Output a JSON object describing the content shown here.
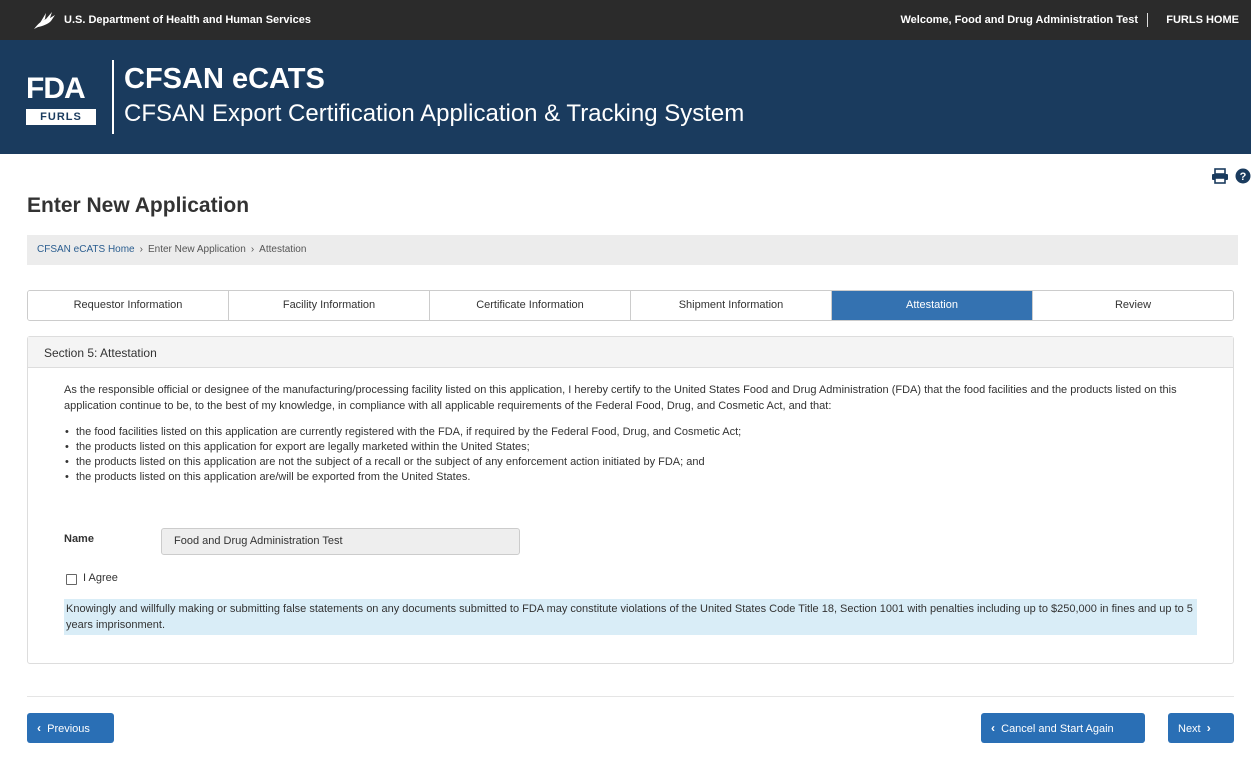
{
  "topbar": {
    "agency": "U.S. Department of Health and Human Services",
    "welcome": "Welcome, Food and Drug Administration Test",
    "home_link": "FURLS HOME"
  },
  "banner": {
    "logo_text": "FDA",
    "logo_sub": "FURLS",
    "title": "CFSAN eCATS",
    "subtitle": "CFSAN Export Certification Application & Tracking System"
  },
  "page": {
    "title": "Enter New Application"
  },
  "breadcrumb": {
    "items": [
      "CFSAN eCATS Home",
      "Enter New Application",
      "Attestation"
    ]
  },
  "tabs": [
    {
      "label": "Requestor Information",
      "active": false
    },
    {
      "label": "Facility Information",
      "active": false
    },
    {
      "label": "Certificate Information",
      "active": false
    },
    {
      "label": "Shipment Information",
      "active": false
    },
    {
      "label": "Attestation",
      "active": true
    },
    {
      "label": "Review",
      "active": false
    }
  ],
  "section": {
    "heading": "Section 5: Attestation",
    "intro": "As the responsible official or designee of the manufacturing/processing facility listed on this application, I hereby certify to the United States Food and Drug Administration (FDA) that the food facilities and the products listed on this application continue to be, to the best of my knowledge, in compliance with all applicable requirements of the Federal Food, Drug, and Cosmetic Act, and that:",
    "bullets": [
      "the food facilities listed on this application are currently registered with the FDA, if required by the Federal Food, Drug, and Cosmetic Act;",
      "the products listed on this application for export are legally marketed within the United States;",
      "the products listed on this application are not the subject of a recall or the subject of any enforcement action initiated by FDA; and",
      "the products listed on this application are/will be exported from the United States."
    ],
    "name_label": "Name",
    "name_value": "Food and Drug Administration Test",
    "agree_label": "I Agree",
    "agree_checked": false,
    "warning": "Knowingly and willfully making or submitting false statements on any documents submitted to FDA may constitute violations of the United States Code Title 18, Section 1001 with penalties including up to $250,000 in fines and up to 5 years imprisonment."
  },
  "buttons": {
    "previous": "Previous",
    "cancel": "Cancel and Start Again",
    "next": "Next"
  },
  "icons": {
    "print": "print-icon",
    "help": "help-icon",
    "hhs": "hhs-eagle-icon"
  },
  "colors": {
    "topbar": "#2b2b2b",
    "banner": "#1a3b5e",
    "accent": "#3472b1",
    "button": "#2a6fb5",
    "warning_bg": "#d9edf7"
  }
}
